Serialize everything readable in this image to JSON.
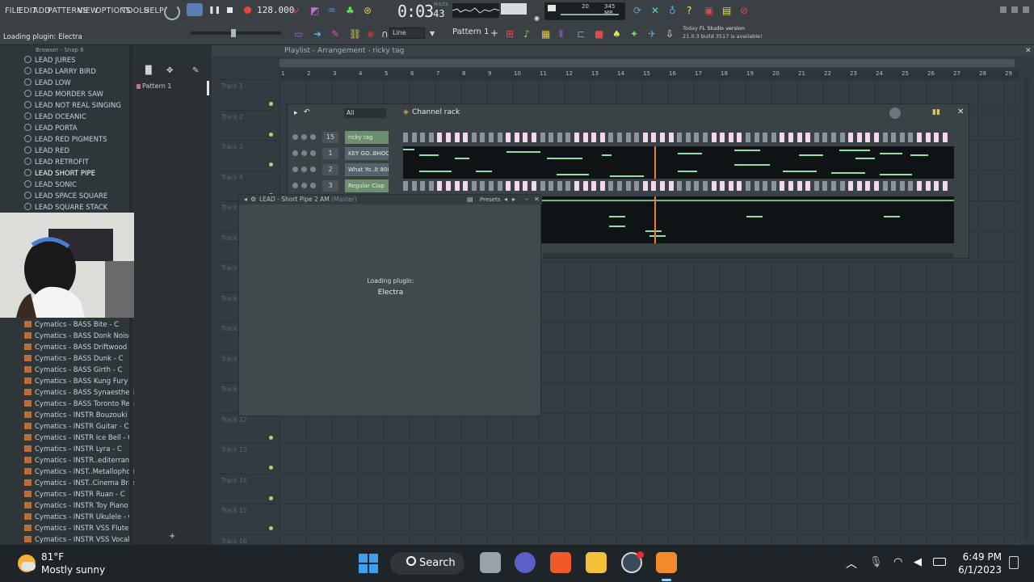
{
  "menu": [
    "FILE",
    "EDIT",
    "ADD",
    "PATTERNS",
    "VIEW",
    "OPTIONS",
    "TOOLS",
    "HELP"
  ],
  "toolbar": {
    "hint": "Loading plugin: Electra",
    "tempo": "128.000",
    "time_main": "0:03",
    "time_sub": "43",
    "time_unit": "M:S:CS",
    "cpu_mem": "345 MB",
    "cpu_num": "20",
    "snap_mode": "Line",
    "pattern": "Pattern 1",
    "news_label": "Today",
    "news_title": "FL Studio version",
    "news_text": "21.0.3 build 3517 is available!"
  },
  "browser": {
    "header": "Browser - Snap 6",
    "items_top": [
      "LEAD JURES",
      "LEAD LARRY BIRD",
      "LEAD LOW",
      "LEAD MORDER SAW",
      "LEAD NOT REAL SINGING",
      "LEAD OCEANIC",
      "LEAD PORTA",
      "LEAD RED PIGMENTS",
      "LEAD RED",
      "LEAD RETROFIT",
      "LEAD SHORT PIPE",
      "LEAD SONIC",
      "LEAD SPACE SQUARE",
      "LEAD SQUARE STACK"
    ],
    "selected_index": 10,
    "items_bottom": [
      "Cymatics - BASS Bite - C",
      "Cymatics - BASS Donk Noise - C",
      "Cymatics - BASS Driftwood - C",
      "Cymatics - BASS Dunk - C",
      "Cymatics - BASS Girth - C",
      "Cymatics - BASS Kung Fury - C",
      "Cymatics - BASS Synaesthesia - C",
      "Cymatics - BASS Toronto Reese - C",
      "Cymatics - INSTR Bouzouki - C",
      "Cymatics - INSTR Guitar - C",
      "Cymatics - INSTR Ice Bell - C",
      "Cymatics - INSTR Lyra - C",
      "Cymatics - INSTR..editerranean - C",
      "Cymatics - INST..Metallophone - C",
      "Cymatics - INST..Cinema Brass - C",
      "Cymatics - INSTR Ruan - C",
      "Cymatics - INSTR Toy Piano - C",
      "Cymatics - INSTR Ukulele - C",
      "Cymatics - INSTR VSS Flute - C",
      "Cymatics - INSTR VSS Vocals - C"
    ]
  },
  "picker": {
    "pattern_item": "Pattern 1"
  },
  "playlist": {
    "title": "Playlist - Arrangement - ricky tag",
    "ruler": [
      "1",
      "2",
      "3",
      "4",
      "5",
      "6",
      "7",
      "8",
      "9",
      "10",
      "11",
      "12",
      "13",
      "14",
      "15",
      "16",
      "17",
      "18",
      "19",
      "20",
      "21",
      "22",
      "23",
      "24",
      "25",
      "26",
      "27",
      "28",
      "29"
    ],
    "tracks": [
      "Track 1",
      "Track 2",
      "Track 3",
      "Track 4",
      "Track 5",
      "Track 6",
      "Track 7",
      "Track 8",
      "Track 9",
      "Track 10",
      "Track 11",
      "Track 12",
      "Track 13",
      "Track 14",
      "Track 15",
      "Track 16"
    ]
  },
  "channel_rack": {
    "title": "Channel rack",
    "filter": "All",
    "channels": [
      {
        "num": "15",
        "name": "ricky tag"
      },
      {
        "num": "1",
        "name": "KEY GO..BHOOD"
      },
      {
        "num": "2",
        "name": "What Yo..It 808"
      },
      {
        "num": "3",
        "name": "Regular Clap"
      }
    ]
  },
  "plugin": {
    "title": "LEAD - Short Pipe 2 AM",
    "title_suffix": "(Master)",
    "presets": "Presets",
    "loading_label": "Loading plugin:",
    "loading_name": "Electra"
  },
  "taskbar": {
    "weather_temp": "81°F",
    "weather_desc": "Mostly sunny",
    "search": "Search",
    "time": "6:49 PM",
    "date": "6/1/2023"
  },
  "colors": {
    "accent_green": "#a9d86a",
    "step_pink": "#f3d8ea",
    "note_green": "#8fe0a8",
    "playhead": "#f07a3a"
  }
}
